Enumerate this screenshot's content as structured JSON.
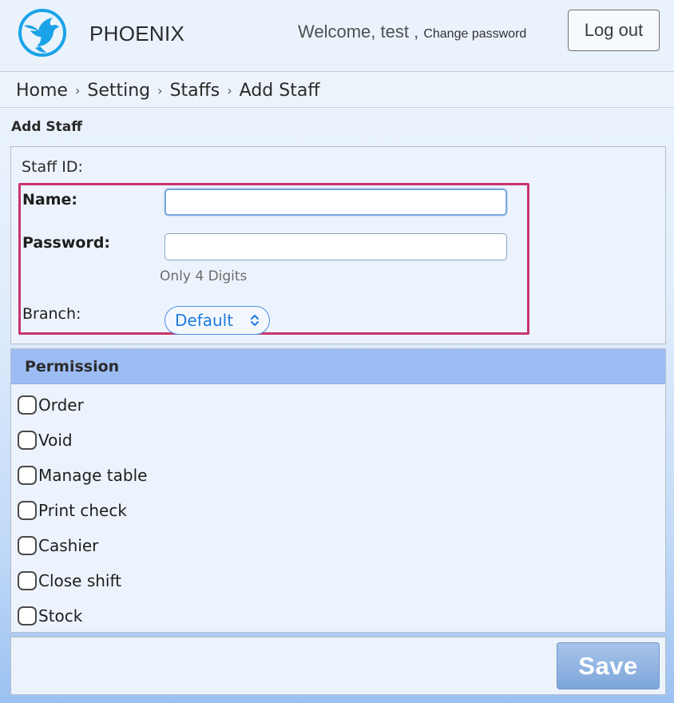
{
  "header": {
    "brand": "PHOENIX",
    "welcome_text": "Welcome, test ,",
    "change_password": "Change password",
    "logout": "Log out"
  },
  "breadcrumb": {
    "items": [
      "Home",
      "Setting",
      "Staffs",
      "Add Staff"
    ],
    "separator": "›"
  },
  "page_title": "Add Staff",
  "form": {
    "staff_id_label": "Staff ID:",
    "name_label": "Name:",
    "name_value": "",
    "password_label": "Password:",
    "password_value": "",
    "password_hint": "Only 4 Digits",
    "branch_label": "Branch:",
    "branch_selected": "Default"
  },
  "permission": {
    "title": "Permission",
    "items": [
      {
        "label": "Order",
        "checked": false
      },
      {
        "label": "Void",
        "checked": false
      },
      {
        "label": "Manage table",
        "checked": false
      },
      {
        "label": "Print check",
        "checked": false
      },
      {
        "label": "Cashier",
        "checked": false
      },
      {
        "label": "Close shift",
        "checked": false
      },
      {
        "label": "Stock",
        "checked": false
      }
    ]
  },
  "actions": {
    "save": "Save"
  },
  "colors": {
    "accent_blue": "#1f7be0",
    "highlight": "#c8356e",
    "permission_header": "#9cbdf4",
    "logo_blue": "#1aa3e8"
  },
  "icons": {
    "logo": "phoenix-bird-logo",
    "select_arrow": "chevron-up-down-icon"
  }
}
